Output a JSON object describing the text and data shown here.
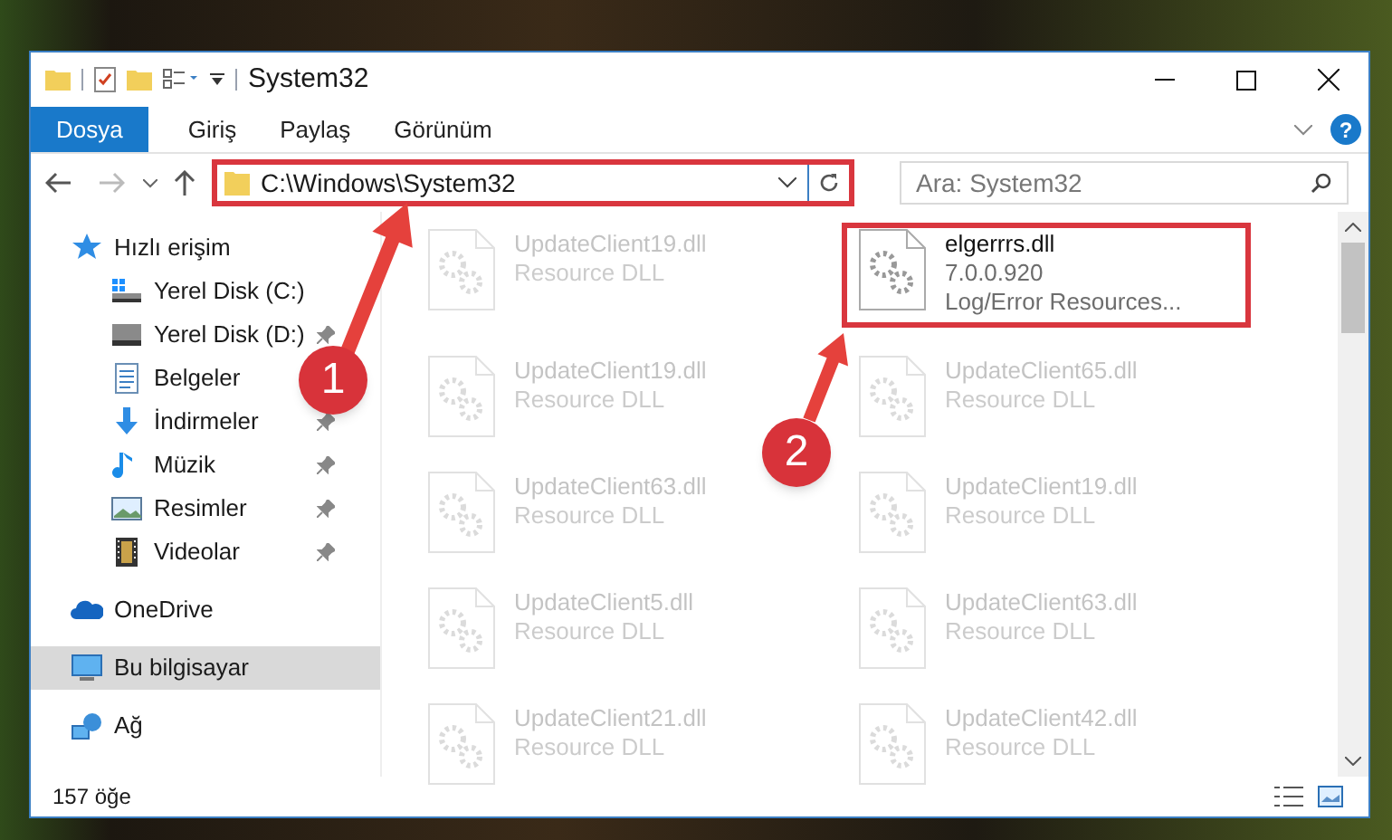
{
  "window": {
    "title": "System32"
  },
  "ribbon_tabs": [
    {
      "label": "Dosya",
      "selected": true
    },
    {
      "label": "Giriş",
      "selected": false
    },
    {
      "label": "Paylaş",
      "selected": false
    },
    {
      "label": "Görünüm",
      "selected": false
    }
  ],
  "help": {
    "label": "?"
  },
  "address": {
    "path": "C:\\Windows\\System32",
    "highlighted": true
  },
  "search": {
    "placeholder": "Ara: System32"
  },
  "nav": [
    {
      "label": "Hızlı erişim",
      "kind": "star",
      "selected": false,
      "pinned": false,
      "children": [
        {
          "label": "Yerel Disk (C:)",
          "kind": "windisk",
          "selected": false,
          "pinned": false
        },
        {
          "label": "Yerel Disk (D:)",
          "kind": "disk",
          "selected": false,
          "pinned": true
        },
        {
          "label": "Belgeler",
          "kind": "docs",
          "selected": false,
          "pinned": false
        },
        {
          "label": "İndirmeler",
          "kind": "download",
          "selected": false,
          "pinned": true
        },
        {
          "label": "Müzik",
          "kind": "music",
          "selected": false,
          "pinned": true
        },
        {
          "label": "Resimler",
          "kind": "pictures",
          "selected": false,
          "pinned": true
        },
        {
          "label": "Videolar",
          "kind": "videos",
          "selected": false,
          "pinned": true
        }
      ]
    },
    {
      "label": "OneDrive",
      "kind": "cloud",
      "selected": false,
      "pinned": false
    },
    {
      "label": "Bu bilgisayar",
      "kind": "pc",
      "selected": true,
      "pinned": false
    },
    {
      "label": "Ağ",
      "kind": "network",
      "selected": false,
      "pinned": false
    }
  ],
  "files": [
    {
      "name": "UpdateClient19.dll",
      "details": [
        "Resource DLL"
      ],
      "faded": true,
      "highlighted": false
    },
    {
      "name": "elgerrrs.dll",
      "details": [
        "7.0.0.920",
        "Log/Error Resources..."
      ],
      "faded": false,
      "highlighted": true
    },
    {
      "name": "UpdateClient19.dll",
      "details": [
        "Resource DLL"
      ],
      "faded": true,
      "highlighted": false
    },
    {
      "name": "UpdateClient65.dll",
      "details": [
        "Resource DLL"
      ],
      "faded": true,
      "highlighted": false
    },
    {
      "name": "UpdateClient63.dll",
      "details": [
        "Resource DLL"
      ],
      "faded": true,
      "highlighted": false
    },
    {
      "name": "UpdateClient19.dll",
      "details": [
        "Resource DLL"
      ],
      "faded": true,
      "highlighted": false
    },
    {
      "name": "UpdateClient5.dll",
      "details": [
        "Resource DLL"
      ],
      "faded": true,
      "highlighted": false
    },
    {
      "name": "UpdateClient63.dll",
      "details": [
        "Resource DLL"
      ],
      "faded": true,
      "highlighted": false
    },
    {
      "name": "UpdateClient21.dll",
      "details": [
        "Resource DLL"
      ],
      "faded": true,
      "highlighted": false
    },
    {
      "name": "UpdateClient42.dll",
      "details": [
        "Resource DLL"
      ],
      "faded": true,
      "highlighted": false
    }
  ],
  "status_bar": {
    "count": "157 öğe"
  },
  "annotations": [
    {
      "label": "1"
    },
    {
      "label": "2"
    }
  ]
}
